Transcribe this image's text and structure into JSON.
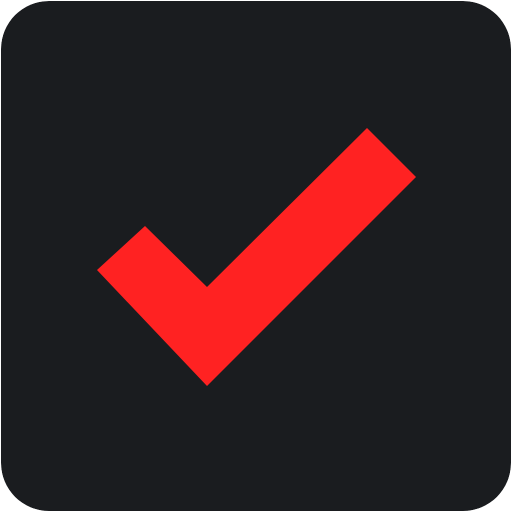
{
  "checkbox": {
    "checked": true,
    "icon": "checkmark-icon",
    "colors": {
      "background": "#1a1c1f",
      "check": "#ff2222"
    }
  }
}
